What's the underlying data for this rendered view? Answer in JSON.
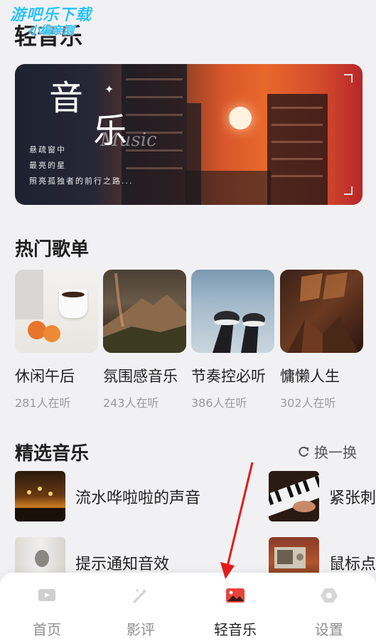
{
  "watermark": {
    "line1": "游吧乐下载",
    "line2": "小编亲测"
  },
  "page": {
    "title": "轻音乐"
  },
  "banner": {
    "char1": "音",
    "char2": "乐",
    "script_word": "Music",
    "poem_lines": [
      "悬疏窗中",
      "最亮的星",
      "照亮孤独者的前行之路..."
    ]
  },
  "hot": {
    "title": "热门歌单",
    "playlists": [
      {
        "name": "休闲午后",
        "listeners": "281人在听"
      },
      {
        "name": "氛围感音乐",
        "listeners": "243人在听"
      },
      {
        "name": "节奏控必听",
        "listeners": "386人在听"
      },
      {
        "name": "慵懒人生",
        "listeners": "302人在听"
      }
    ]
  },
  "featured": {
    "title": "精选音乐",
    "refresh_label": "换一换",
    "tracks": [
      {
        "name": "流水哗啦啦的声音"
      },
      {
        "name": "紧张刺"
      },
      {
        "name": "提示通知音效"
      },
      {
        "name": "鼠标点"
      }
    ]
  },
  "tabbar": {
    "tabs": [
      {
        "label": "首页",
        "icon": "video-icon"
      },
      {
        "label": "影评",
        "icon": "magic-wand-icon"
      },
      {
        "label": "轻音乐",
        "icon": "image-icon",
        "active": true
      },
      {
        "label": "设置",
        "icon": "settings-icon"
      }
    ]
  },
  "colors": {
    "active_icon": "#e8443a",
    "inactive_icon": "#c8c8c8",
    "annotation_arrow": "#e31b1b"
  }
}
